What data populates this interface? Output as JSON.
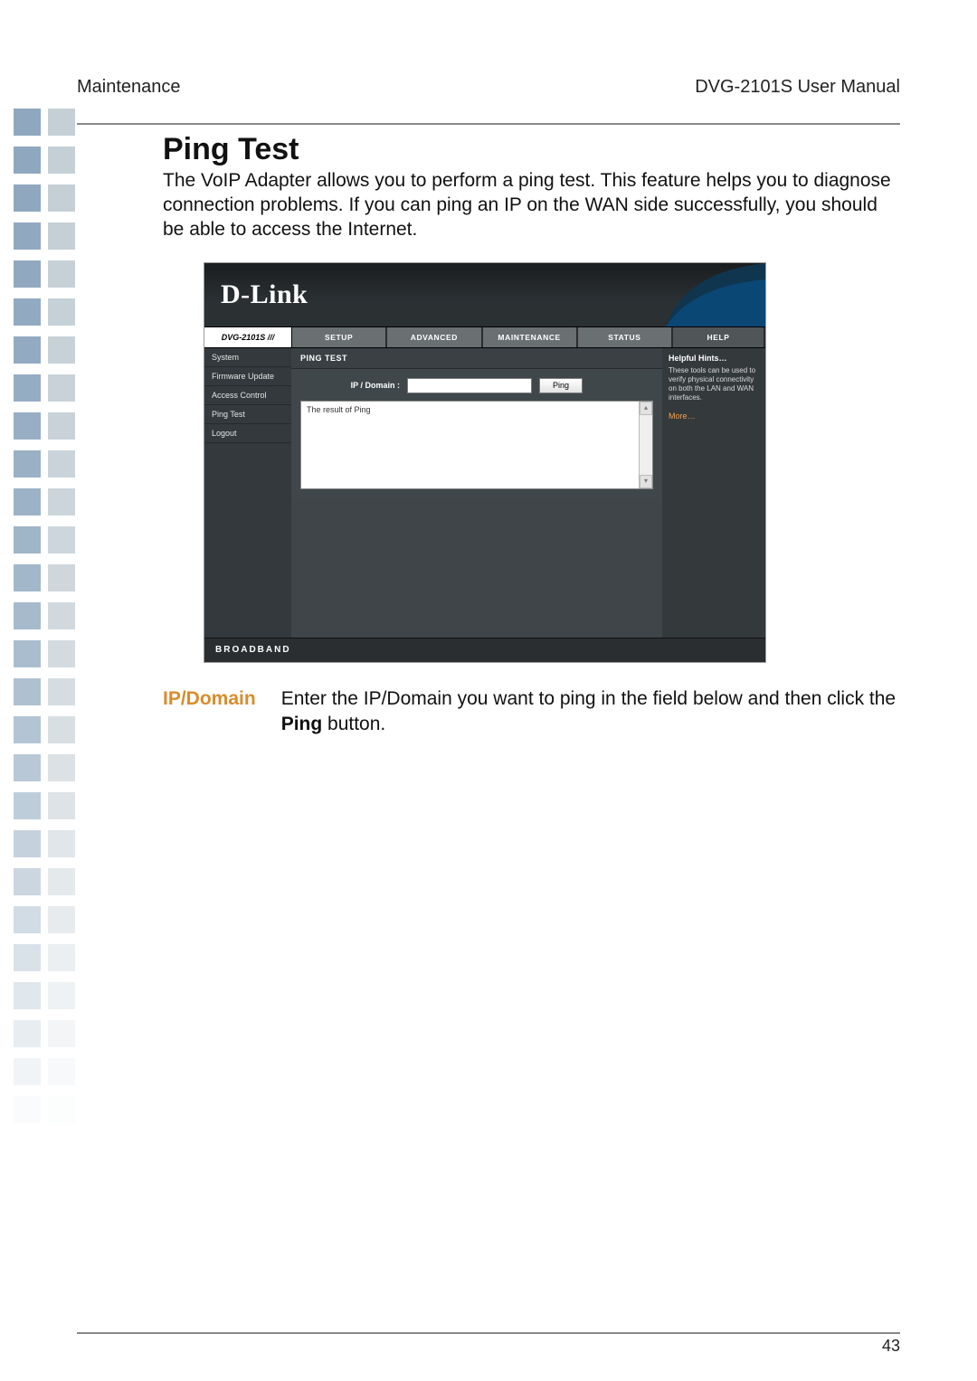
{
  "header": {
    "left": "Maintenance",
    "right": "DVG-2101S User Manual"
  },
  "title": "Ping Test",
  "intro": "The VoIP Adapter allows you to perform a ping test. This feature helps you to diagnose connection problems. If you can ping an IP on the WAN side successfully, you should be able to access the Internet.",
  "screenshot": {
    "brand": "D-Link",
    "model": "DVG-2101S",
    "tabs": [
      "SETUP",
      "ADVANCED",
      "MAINTENANCE",
      "STATUS"
    ],
    "help_tab": "HELP",
    "sidebar": [
      "System",
      "Firmware Update",
      "Access Control",
      "Ping Test",
      "Logout"
    ],
    "panel_title": "PING TEST",
    "field_label": "IP / Domain :",
    "button": "Ping",
    "result_label": "The result of Ping",
    "help": {
      "title": "Helpful Hints…",
      "text": "These tools can be used to verify physical connectivity on both the LAN and WAN interfaces.",
      "more": "More…"
    },
    "footer": "BROADBAND"
  },
  "definition": {
    "term": "IP/Domain",
    "text_a": "Enter the IP/Domain you want to ping in the field below and then click the ",
    "bold": "Ping",
    "text_b": " button."
  },
  "page_number": "43",
  "deco_colors": [
    "#8fa8bf",
    "#c5cfd6"
  ]
}
